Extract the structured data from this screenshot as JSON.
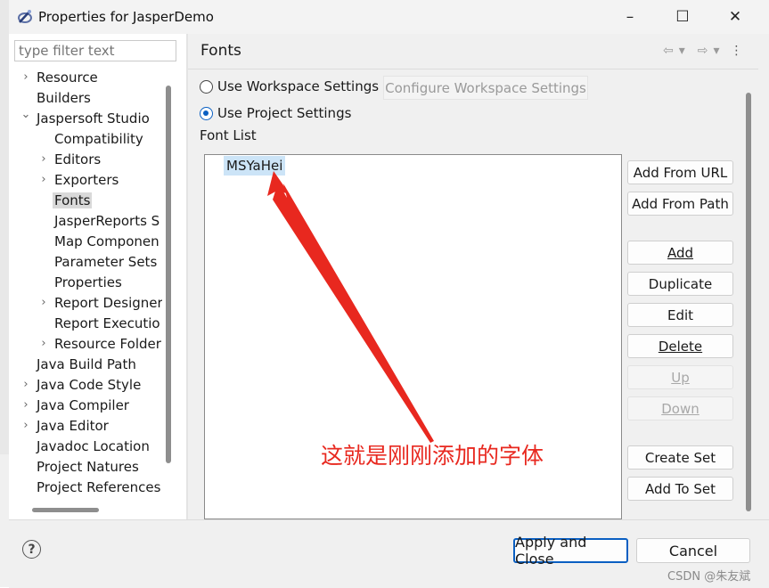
{
  "window": {
    "title": "Properties for JasperDemo",
    "controls": {
      "minimize": "–",
      "maximize": "☐",
      "close": "✕"
    }
  },
  "filter": {
    "placeholder": "type filter text"
  },
  "tree": [
    {
      "label": "Resource",
      "expandable": true
    },
    {
      "label": "Builders",
      "expandable": false
    },
    {
      "label": "Jaspersoft Studio",
      "expandable": true,
      "expanded": true
    },
    {
      "label": "Compatibility",
      "expandable": false
    },
    {
      "label": "Editors",
      "expandable": true
    },
    {
      "label": "Exporters",
      "expandable": true
    },
    {
      "label": "Fonts",
      "expandable": false,
      "selected": true
    },
    {
      "label": "JasperReports S",
      "expandable": false
    },
    {
      "label": "Map Componen",
      "expandable": false
    },
    {
      "label": "Parameter Sets",
      "expandable": false
    },
    {
      "label": "Properties",
      "expandable": false
    },
    {
      "label": "Report Designer",
      "expandable": true
    },
    {
      "label": "Report Executio",
      "expandable": false
    },
    {
      "label": "Resource Folder",
      "expandable": true
    },
    {
      "label": "Java Build Path",
      "expandable": false
    },
    {
      "label": "Java Code Style",
      "expandable": true
    },
    {
      "label": "Java Compiler",
      "expandable": true
    },
    {
      "label": "Java Editor",
      "expandable": true
    },
    {
      "label": "Javadoc Location",
      "expandable": false
    },
    {
      "label": "Project Natures",
      "expandable": false
    },
    {
      "label": "Project References",
      "expandable": false
    }
  ],
  "page": {
    "title": "Fonts",
    "nav": {
      "back": "⇦",
      "dropdown": "▾",
      "forward": "⇨",
      "menu": "⋮"
    },
    "use_workspace": "Use Workspace Settings",
    "configure_workspace": "Configure Workspace Settings",
    "use_project": "Use Project Settings",
    "font_list_label": "Font List",
    "fonts": [
      "MSYaHei"
    ]
  },
  "buttons": {
    "add_from_url": "Add From URL",
    "add_from_path": "Add From Path",
    "add": "Add",
    "duplicate": "Duplicate",
    "edit": "Edit",
    "delete": "Delete",
    "up": "Up",
    "down": "Down",
    "create_set": "Create Set",
    "add_to_set": "Add To Set"
  },
  "annotation": "这就是刚刚添加的字体",
  "footer": {
    "help": "?",
    "apply_close": "Apply and Close",
    "cancel": "Cancel",
    "watermark": "CSDN @朱友斌"
  },
  "colors": {
    "accent": "#0a5fc2",
    "selection": "#cce4f7",
    "annotation": "#e8281f"
  }
}
